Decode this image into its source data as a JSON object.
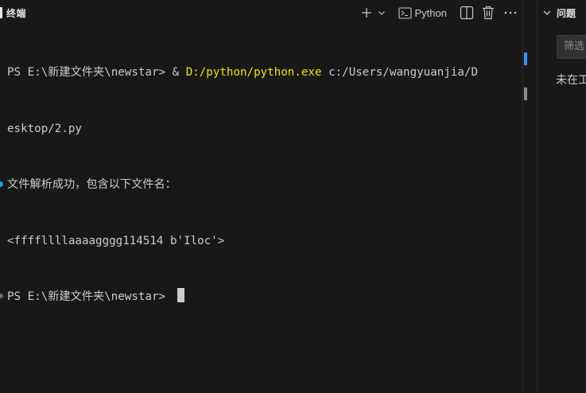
{
  "terminal": {
    "title": "终端",
    "actions": {
      "new_terminal_icon": "plus-icon",
      "dropdown_icon": "chevron-down-icon",
      "profile_label": "Python",
      "split_icon": "split-icon",
      "kill_icon": "trash-icon",
      "more_icon": "ellipsis-icon"
    },
    "lines": [
      {
        "prompt": "PS E:\\新建文件夹\\newstar> & ",
        "command": "D:/python/python.exe",
        "args": " c:/Users/wangyuanjia/D"
      },
      {
        "text": "esktop/2.py"
      },
      {
        "text": "文件解析成功，包含以下文件名："
      },
      {
        "text": "<ffffllllaaaagggg114514 b'Iloc'>"
      },
      {
        "text": "PS E:\\新建文件夹\\newstar> "
      }
    ]
  },
  "problems": {
    "title": "问题",
    "filter_placeholder": "筛选",
    "empty_message": "未在工"
  },
  "colors": {
    "background": "#181818",
    "text": "#cccccc",
    "executable": "#e5e510",
    "success_decoration": "#1f9cd6"
  }
}
